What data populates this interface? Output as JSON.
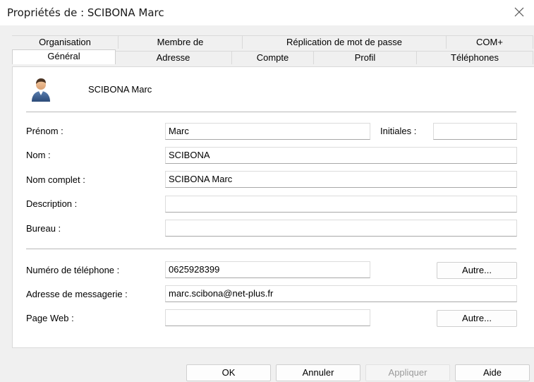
{
  "window": {
    "title": "Propriétés de : SCIBONA Marc"
  },
  "tabs_row1": [
    "Organisation",
    "Membre de",
    "Réplication de mot de passe",
    "COM+"
  ],
  "tabs_row2": [
    "Général",
    "Adresse",
    "Compte",
    "Profil",
    "Téléphones"
  ],
  "user": {
    "display_name": "SCIBONA Marc",
    "icon": "user-icon"
  },
  "form": {
    "prenom_label": "Prénom :",
    "prenom_value": "Marc",
    "initiales_label": "Initiales :",
    "initiales_value": "",
    "nom_label": "Nom :",
    "nom_value": "SCIBONA",
    "nom_complet_label": "Nom complet :",
    "nom_complet_value": "SCIBONA Marc",
    "description_label": "Description :",
    "description_value": "",
    "bureau_label": "Bureau :",
    "bureau_value": "",
    "telephone_label": "Numéro de téléphone :",
    "telephone_value": "0625928399",
    "telephone_autre": "Autre...",
    "email_label": "Adresse de messagerie :",
    "email_value": "marc.scibona@net-plus.fr",
    "web_label": "Page Web :",
    "web_value": "",
    "web_autre": "Autre..."
  },
  "buttons": {
    "ok": "OK",
    "annuler": "Annuler",
    "appliquer": "Appliquer",
    "aide": "Aide"
  },
  "colors": {
    "dialog_bg": "#f0f0f0",
    "panel_bg": "#ffffff",
    "disabled_text": "#9a9a9a"
  }
}
